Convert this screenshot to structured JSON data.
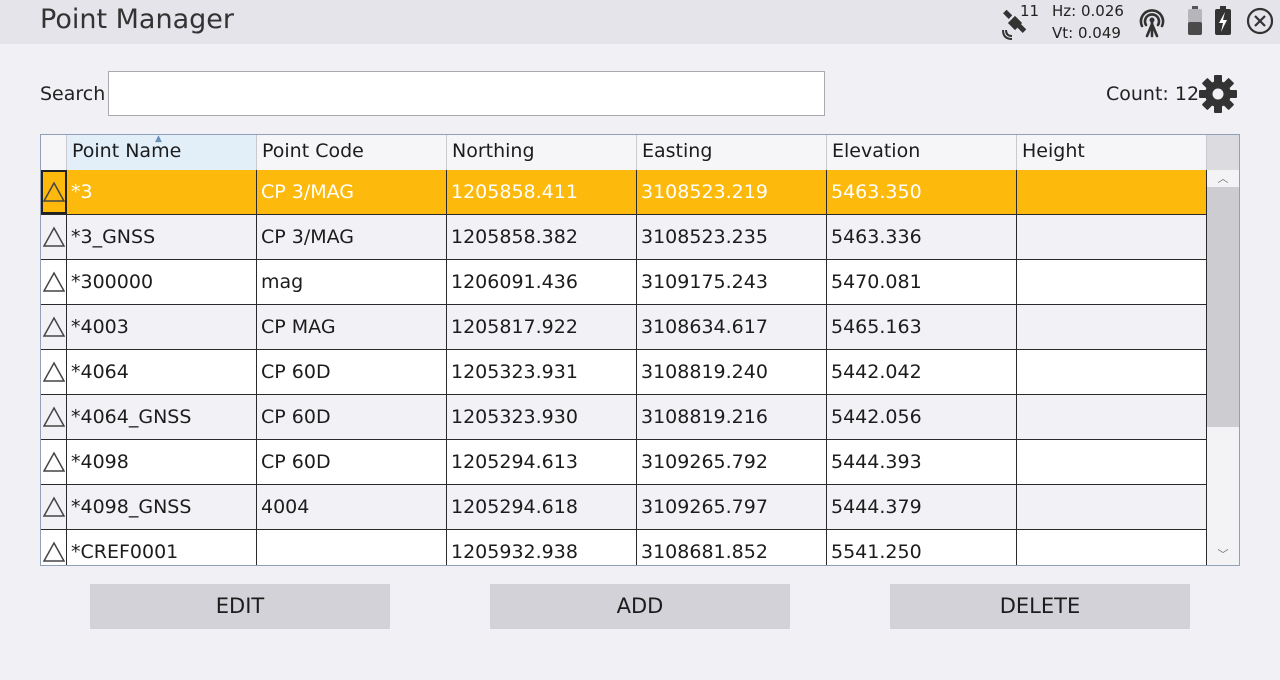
{
  "app": {
    "title": "Point Manager"
  },
  "status": {
    "satellite_count": "11",
    "hz": "Hz: 0.026",
    "vt": "Vt: 0.049",
    "icons": [
      "satellite-icon",
      "radio-link-icon",
      "battery-icon",
      "battery-charging-icon",
      "close-icon"
    ]
  },
  "search": {
    "label": "Search",
    "value": "",
    "placeholder": ""
  },
  "count": {
    "label": "Count: 12"
  },
  "table": {
    "columns": [
      "Point Name",
      "Point Code",
      "Northing",
      "Easting",
      "Elevation",
      "Height"
    ],
    "rows": [
      {
        "name": "*3",
        "code": "CP 3/MAG",
        "northing": "1205858.411",
        "easting": "3108523.219",
        "elevation": "5463.350",
        "height": ""
      },
      {
        "name": "*3_GNSS",
        "code": "CP 3/MAG",
        "northing": "1205858.382",
        "easting": "3108523.235",
        "elevation": "5463.336",
        "height": ""
      },
      {
        "name": "*300000",
        "code": "mag",
        "northing": "1206091.436",
        "easting": "3109175.243",
        "elevation": "5470.081",
        "height": ""
      },
      {
        "name": "*4003",
        "code": "CP MAG",
        "northing": "1205817.922",
        "easting": "3108634.617",
        "elevation": "5465.163",
        "height": ""
      },
      {
        "name": "*4064",
        "code": "CP 60D",
        "northing": "1205323.931",
        "easting": "3108819.240",
        "elevation": "5442.042",
        "height": ""
      },
      {
        "name": "*4064_GNSS",
        "code": "CP 60D",
        "northing": "1205323.930",
        "easting": "3108819.216",
        "elevation": "5442.056",
        "height": ""
      },
      {
        "name": "*4098",
        "code": "CP 60D",
        "northing": "1205294.613",
        "easting": "3109265.792",
        "elevation": "5444.393",
        "height": ""
      },
      {
        "name": "*4098_GNSS",
        "code": "4004",
        "northing": "1205294.618",
        "easting": "3109265.797",
        "elevation": "5444.379",
        "height": ""
      },
      {
        "name": "*CREF0001",
        "code": "",
        "northing": "1205932.938",
        "easting": "3108681.852",
        "elevation": "5541.250",
        "height": ""
      }
    ],
    "selected_row": 0,
    "accent_color": "#fdba0d"
  },
  "buttons": {
    "edit": "EDIT",
    "add": "ADD",
    "delete": "DELETE"
  }
}
